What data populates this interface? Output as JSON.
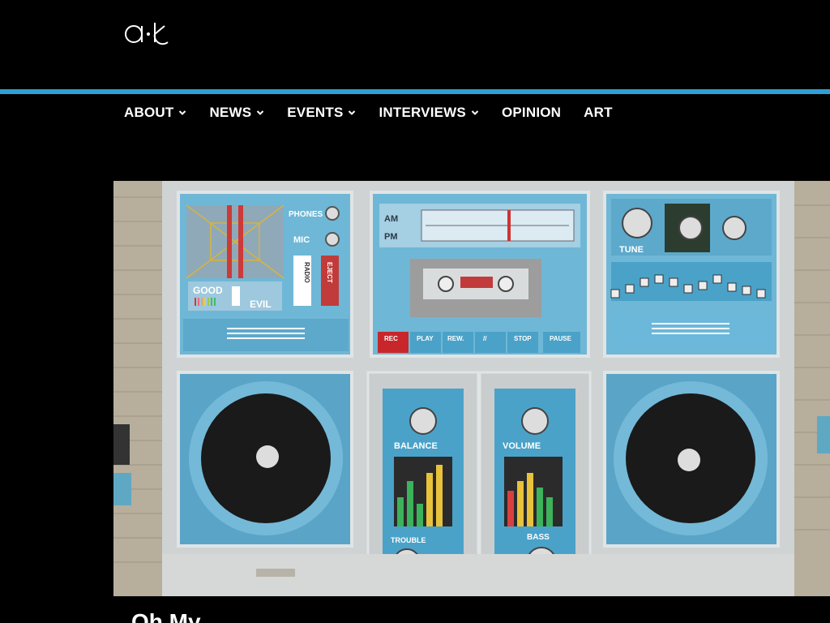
{
  "site": {
    "logo_text": "a·k"
  },
  "nav": {
    "items": [
      {
        "label": "ABOUT",
        "has_dropdown": true
      },
      {
        "label": "NEWS",
        "has_dropdown": true
      },
      {
        "label": "EVENTS",
        "has_dropdown": true
      },
      {
        "label": "INTERVIEWS",
        "has_dropdown": true
      },
      {
        "label": "OPINION",
        "has_dropdown": false
      },
      {
        "label": "ART",
        "has_dropdown": false
      }
    ]
  },
  "colors": {
    "accent": "#2f9fd6",
    "background": "#000000",
    "mural_blue": "#5fb4d8"
  },
  "hero": {
    "radio_labels": {
      "phones": "PHONES",
      "mic": "MIC",
      "radio": "RADIO",
      "eject": "EJECT",
      "good": "GOOD",
      "evil": "EVIL",
      "am": "AM",
      "pm": "PM",
      "tune": "TUNE",
      "rec": "REC",
      "play": "PLAY",
      "rew": "REW.",
      "ff": "//",
      "stop": "STOP",
      "pause": "PAUSE",
      "balance": "BALANCE",
      "volume": "VOLUME",
      "trouble": "TROUBLE",
      "bass": "BASS"
    }
  },
  "article": {
    "title_fragment": "Oh My..."
  }
}
